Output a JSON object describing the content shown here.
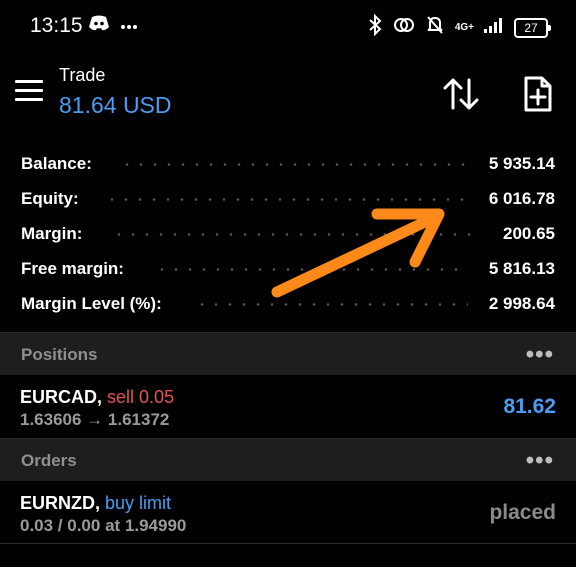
{
  "status_bar": {
    "time": "13:15",
    "network": "4G+",
    "battery": "27"
  },
  "header": {
    "title": "Trade",
    "subtitle": "81.64 USD"
  },
  "summary": [
    {
      "label": "Balance:",
      "value": "5 935.14"
    },
    {
      "label": "Equity:",
      "value": "6 016.78"
    },
    {
      "label": "Margin:",
      "value": "200.65"
    },
    {
      "label": "Free margin:",
      "value": "5 816.13"
    },
    {
      "label": "Margin Level (%):",
      "value": "2 998.64"
    }
  ],
  "positions": {
    "title": "Positions",
    "more": "•••",
    "items": [
      {
        "symbol": "EURCAD",
        "sep": ", ",
        "side": "sell 0.05",
        "detail": "1.63606 → 1.61372",
        "right": "81.62"
      }
    ]
  },
  "orders": {
    "title": "Orders",
    "more": "•••",
    "items": [
      {
        "symbol": "EURNZD",
        "sep": ", ",
        "side": "buy limit",
        "detail": "0.03 / 0.00 at 1.94990",
        "right": "placed"
      }
    ]
  },
  "colors": {
    "accent_blue": "#4b9cf3",
    "sell_red": "#e35555",
    "annotation_orange": "#ff8a1a"
  }
}
